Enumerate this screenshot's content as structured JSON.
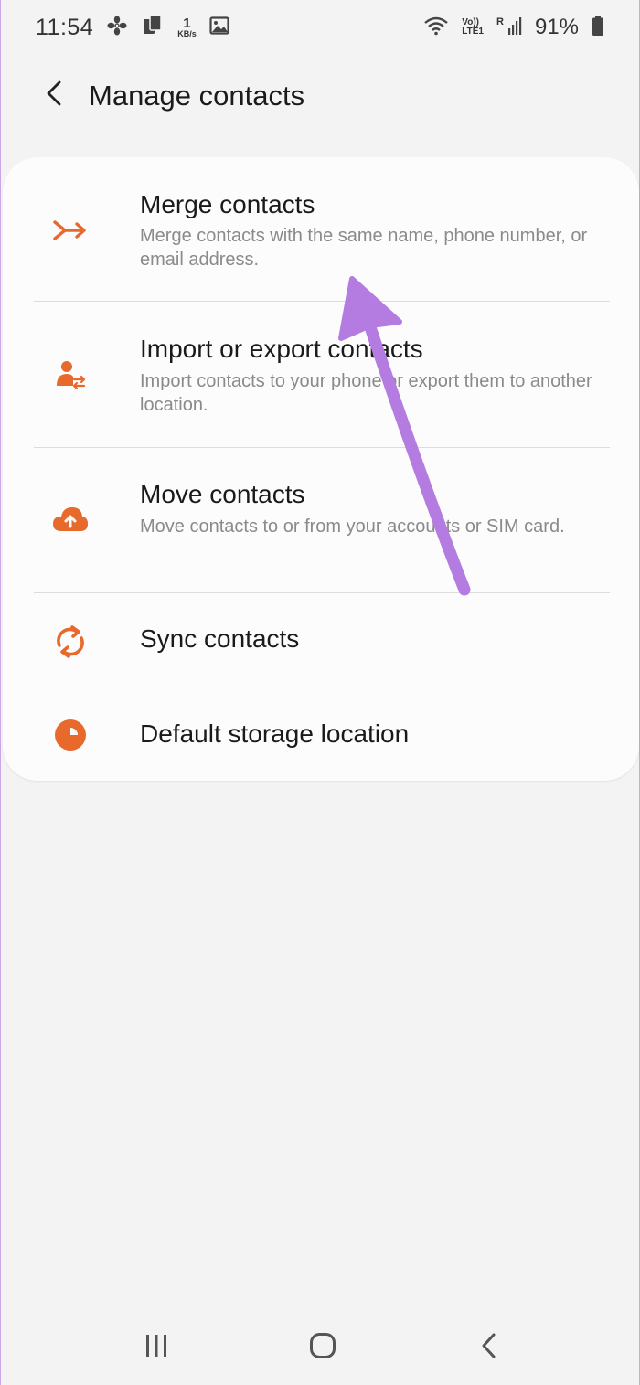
{
  "status_bar": {
    "time": "11:54",
    "speed_value": "1",
    "speed_unit": "KB/s",
    "network_top": "Vo))",
    "network_bottom": "LTE1",
    "roaming": "R",
    "battery_percent": "91%"
  },
  "header": {
    "title": "Manage contacts",
    "back_icon": "chevron-left-icon"
  },
  "menu": {
    "items": [
      {
        "title": "Merge contacts",
        "description": "Merge contacts with the same name, phone number, or email address.",
        "icon": "merge-icon"
      },
      {
        "title": "Import or export contacts",
        "description": "Import contacts to your phone or export them to another location.",
        "icon": "import-export-icon"
      },
      {
        "title": "Move contacts",
        "description": "Move contacts to or from your accounts or SIM card.",
        "icon": "cloud-upload-icon"
      },
      {
        "title": "Sync contacts",
        "description": "",
        "icon": "sync-icon"
      },
      {
        "title": "Default storage location",
        "description": "",
        "icon": "storage-icon"
      }
    ]
  },
  "colors": {
    "accent": "#e8692c",
    "background": "#f3f3f3",
    "card": "#fcfcfc",
    "annotation_arrow": "#b47be0"
  },
  "nav_bar": {
    "recents_icon": "recents-icon",
    "home_icon": "home-icon",
    "back_icon": "back-nav-icon"
  }
}
